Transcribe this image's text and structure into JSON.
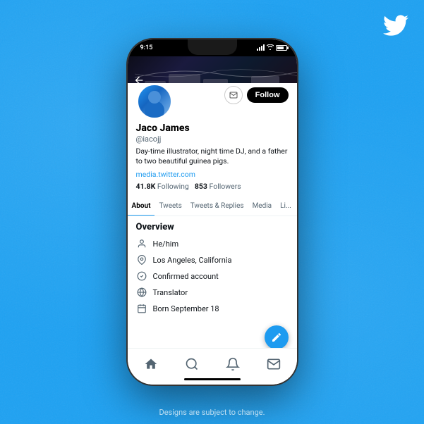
{
  "twitter_bird": "🐦",
  "disclaimer": "Designs are subject to change.",
  "phone": {
    "status_bar": {
      "time": "9:15",
      "signal": "full",
      "wifi": true,
      "battery": "full"
    },
    "cover_photo": {
      "alt": "Stage equipment background"
    },
    "profile": {
      "name": "Jaco James",
      "handle": "@iacojj",
      "bio": "Day-time illustrator, night time DJ, and a father to two beautiful guinea pigs.",
      "link": "media.twitter.com",
      "following_count": "41.8K",
      "following_label": "Following",
      "followers_count": "853",
      "followers_label": "Followers"
    },
    "actions": {
      "message_icon": "✉",
      "follow_label": "Follow"
    },
    "tabs": [
      {
        "label": "About",
        "active": true
      },
      {
        "label": "Tweets",
        "active": false
      },
      {
        "label": "Tweets & Replies",
        "active": false
      },
      {
        "label": "Media",
        "active": false
      },
      {
        "label": "Li...",
        "active": false
      }
    ],
    "overview": {
      "title": "Overview",
      "items": [
        {
          "icon": "person",
          "text": "He/him"
        },
        {
          "icon": "location",
          "text": "Los Angeles, California"
        },
        {
          "icon": "verified",
          "text": "Confirmed account"
        },
        {
          "icon": "globe",
          "text": "Translator"
        },
        {
          "icon": "birthday",
          "text": "Born September 18"
        }
      ]
    },
    "fab_icon": "✦",
    "nav": {
      "home_icon": "⌂",
      "search_icon": "🔍",
      "bell_icon": "🔔",
      "mail_icon": "✉"
    }
  }
}
